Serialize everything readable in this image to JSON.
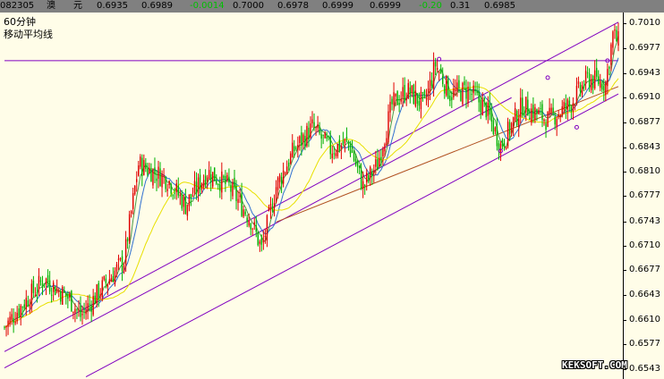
{
  "header": {
    "symbol_code": "082305",
    "name_chars": [
      "澳",
      "元"
    ],
    "fields": [
      "0.6935",
      "0.6989",
      "-0.0014",
      "0.7000",
      "0.6978",
      "0.6999",
      "0.6999",
      "-0.20",
      "0.31",
      "0.6985"
    ]
  },
  "panel": {
    "period_label": "60分钟",
    "indicator_label": "移动平均线"
  },
  "watermark": "KEKSOFT.COM",
  "colors": {
    "background": "#fffde8",
    "header_bar": "#808080",
    "candle_up": "#e00000",
    "candle_down": "#00b000",
    "ma_short": "#4a9a4a",
    "ma_mid": "#3070d0",
    "ma_long": "#e8e000",
    "trendline": "#8000c0",
    "resistance_line": "#8000c0",
    "lower_trend_brown": "#b05020",
    "header_negative": "#00c000",
    "header_text": "#000000"
  },
  "chart_data": {
    "type": "candlestick",
    "y_axis_side": "right",
    "ylim": [
      0.653,
      0.7025
    ],
    "yticks": [
      "0.7010",
      "0.6977",
      "0.6943",
      "0.6910",
      "0.6877",
      "0.6843",
      "0.6810",
      "0.6777",
      "0.6743",
      "0.6710",
      "0.6677",
      "0.6643",
      "0.6610",
      "0.6577",
      "0.6543"
    ],
    "bar_count": 340,
    "anchors": [
      {
        "bar": 0,
        "price": 0.66
      },
      {
        "bar": 8,
        "price": 0.6625
      },
      {
        "bar": 22,
        "price": 0.6665
      },
      {
        "bar": 36,
        "price": 0.6638
      },
      {
        "bar": 42,
        "price": 0.6615
      },
      {
        "bar": 56,
        "price": 0.666
      },
      {
        "bar": 66,
        "price": 0.669
      },
      {
        "bar": 74,
        "price": 0.682
      },
      {
        "bar": 90,
        "price": 0.68
      },
      {
        "bar": 100,
        "price": 0.6765
      },
      {
        "bar": 112,
        "price": 0.681
      },
      {
        "bar": 124,
        "price": 0.679
      },
      {
        "bar": 136,
        "price": 0.6745
      },
      {
        "bar": 142,
        "price": 0.6705
      },
      {
        "bar": 150,
        "price": 0.679
      },
      {
        "bar": 160,
        "price": 0.684
      },
      {
        "bar": 170,
        "price": 0.687
      },
      {
        "bar": 180,
        "price": 0.684
      },
      {
        "bar": 190,
        "price": 0.685
      },
      {
        "bar": 198,
        "price": 0.679
      },
      {
        "bar": 206,
        "price": 0.682
      },
      {
        "bar": 214,
        "price": 0.69
      },
      {
        "bar": 222,
        "price": 0.692
      },
      {
        "bar": 232,
        "price": 0.69
      },
      {
        "bar": 238,
        "price": 0.6955
      },
      {
        "bar": 246,
        "price": 0.6915
      },
      {
        "bar": 256,
        "price": 0.692
      },
      {
        "bar": 266,
        "price": 0.6895
      },
      {
        "bar": 274,
        "price": 0.6845
      },
      {
        "bar": 286,
        "price": 0.69
      },
      {
        "bar": 300,
        "price": 0.688
      },
      {
        "bar": 312,
        "price": 0.69
      },
      {
        "bar": 322,
        "price": 0.6935
      },
      {
        "bar": 332,
        "price": 0.693
      },
      {
        "bar": 336,
        "price": 0.6995
      },
      {
        "bar": 339,
        "price": 0.6985
      }
    ],
    "moving_averages": [
      {
        "period": 5
      },
      {
        "period": 10
      },
      {
        "period": 30
      }
    ],
    "trendlines": [
      {
        "kind": "horizontal",
        "price": 0.696,
        "from_bar": 0,
        "to_bar": 339
      },
      {
        "kind": "channel_upper",
        "from": {
          "bar": 0,
          "price": 0.6567
        },
        "to": {
          "bar": 339,
          "price": 0.7012
        }
      },
      {
        "kind": "channel_lower",
        "from": {
          "bar": 45,
          "price": 0.6533
        },
        "to": {
          "bar": 339,
          "price": 0.6915
        }
      },
      {
        "kind": "channel_mid",
        "from": {
          "bar": 0,
          "price": 0.6545
        },
        "to": {
          "bar": 280,
          "price": 0.691
        }
      }
    ]
  }
}
